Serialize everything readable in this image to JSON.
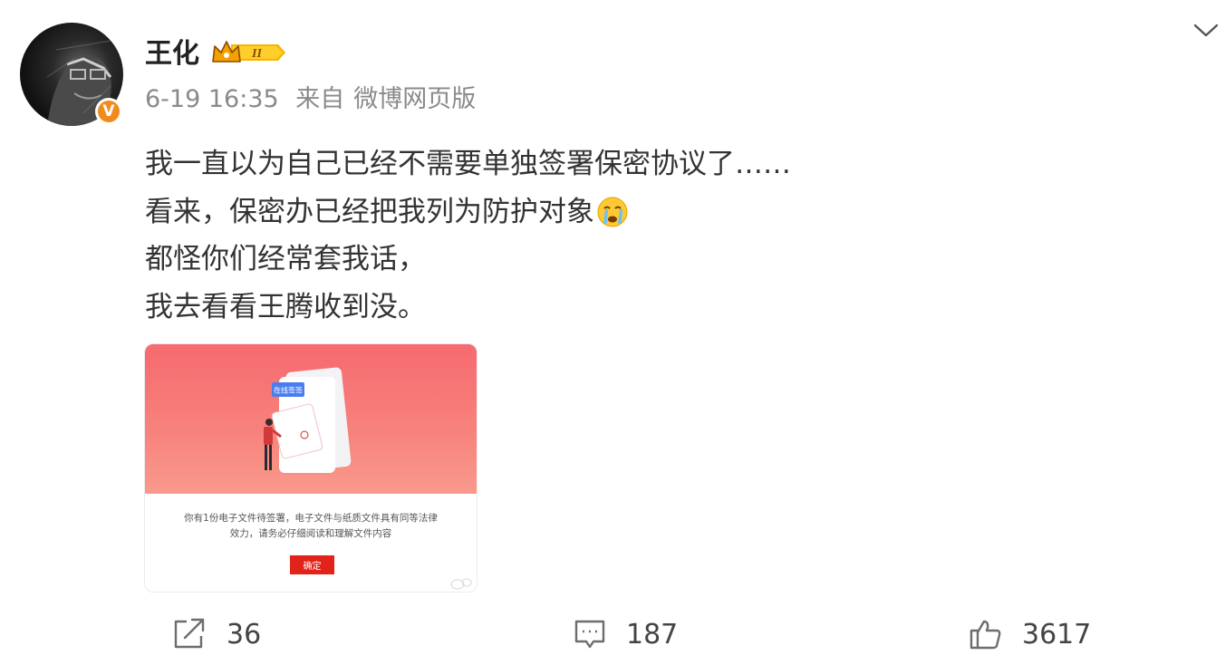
{
  "post": {
    "author": {
      "name": "王化",
      "verified_badge": "V",
      "vip_level": "II"
    },
    "time": "6-19 16:35",
    "source_prefix": "来自",
    "source": "微博网页版",
    "content_lines": [
      "我一直以为自己已经不需要单独签署保密协议了……",
      "看来，保密办已经把我列为防护对象",
      "都怪你们经常套我话，",
      "我去看看王腾收到没。"
    ],
    "image": {
      "tag_label": "在线签签",
      "description_line1": "你有1份电子文件待签署，电子文件与纸质文件具有同等法律",
      "description_line2": "效力，请务必仔细阅读和理解文件内容",
      "button_label": "确定"
    },
    "actions": {
      "repost_count": "36",
      "comment_count": "187",
      "like_count": "3617"
    }
  },
  "icons": {
    "menu": "chevron-down-icon",
    "repost": "repost-icon",
    "comment": "comment-icon",
    "like": "thumbs-up-icon",
    "emoji": "crying-emoji-icon"
  },
  "colors": {
    "verified": "#f08a1c",
    "card_top": "#f66a6f",
    "confirm_button": "#e2231a"
  }
}
